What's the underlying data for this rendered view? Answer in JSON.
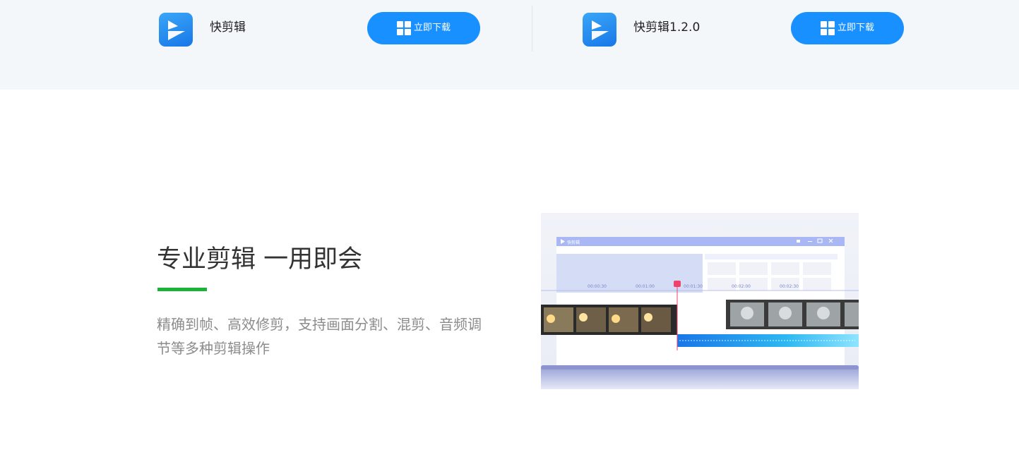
{
  "downloads": [
    {
      "app_name": "快剪辑",
      "icon": "kuaijianji-logo-icon",
      "button_label": "立即下载",
      "button_icon": "windows-icon"
    },
    {
      "app_name": "快剪辑1.2.0",
      "icon": "kuaijianji-logo-icon",
      "button_label": "立即下载",
      "button_icon": "windows-icon"
    }
  ],
  "feature": {
    "title": "专业剪辑 一用即会",
    "description": "精确到帧、高效修剪，支持画面分割、混剪、音频调节等多种剪辑操作",
    "accent_color": "#19b433"
  },
  "preview": {
    "window_title": "快剪辑",
    "timeline_ticks": [
      "00:00:30",
      "00:01:00",
      "00:01:30",
      "00:02:00",
      "00:02:30"
    ]
  },
  "colors": {
    "button": "#1890ff",
    "top_band": "#f3f7fa",
    "playhead": "#f0436c"
  }
}
